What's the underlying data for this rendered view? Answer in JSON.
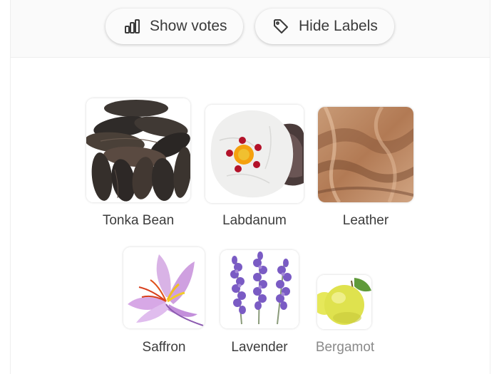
{
  "toolbar": {
    "show_votes": {
      "label": "Show votes",
      "icon": "bar-chart-icon"
    },
    "hide_labels": {
      "label": "Hide Labels",
      "icon": "tag-icon"
    }
  },
  "notes": [
    {
      "label": "Tonka Bean",
      "image": "tonka-bean-photo"
    },
    {
      "label": "Labdanum",
      "image": "labdanum-flower-photo"
    },
    {
      "label": "Leather",
      "image": "leather-photo"
    },
    {
      "label": "Saffron",
      "image": "saffron-flower-photo"
    },
    {
      "label": "Lavender",
      "image": "lavender-photo"
    },
    {
      "label": "Bergamot",
      "image": "bergamot-fruit-photo",
      "muted": true
    }
  ],
  "colors": {
    "text": "#3a3a3a",
    "muted_text": "#8a8a8a",
    "background": "#fbfbfb"
  }
}
